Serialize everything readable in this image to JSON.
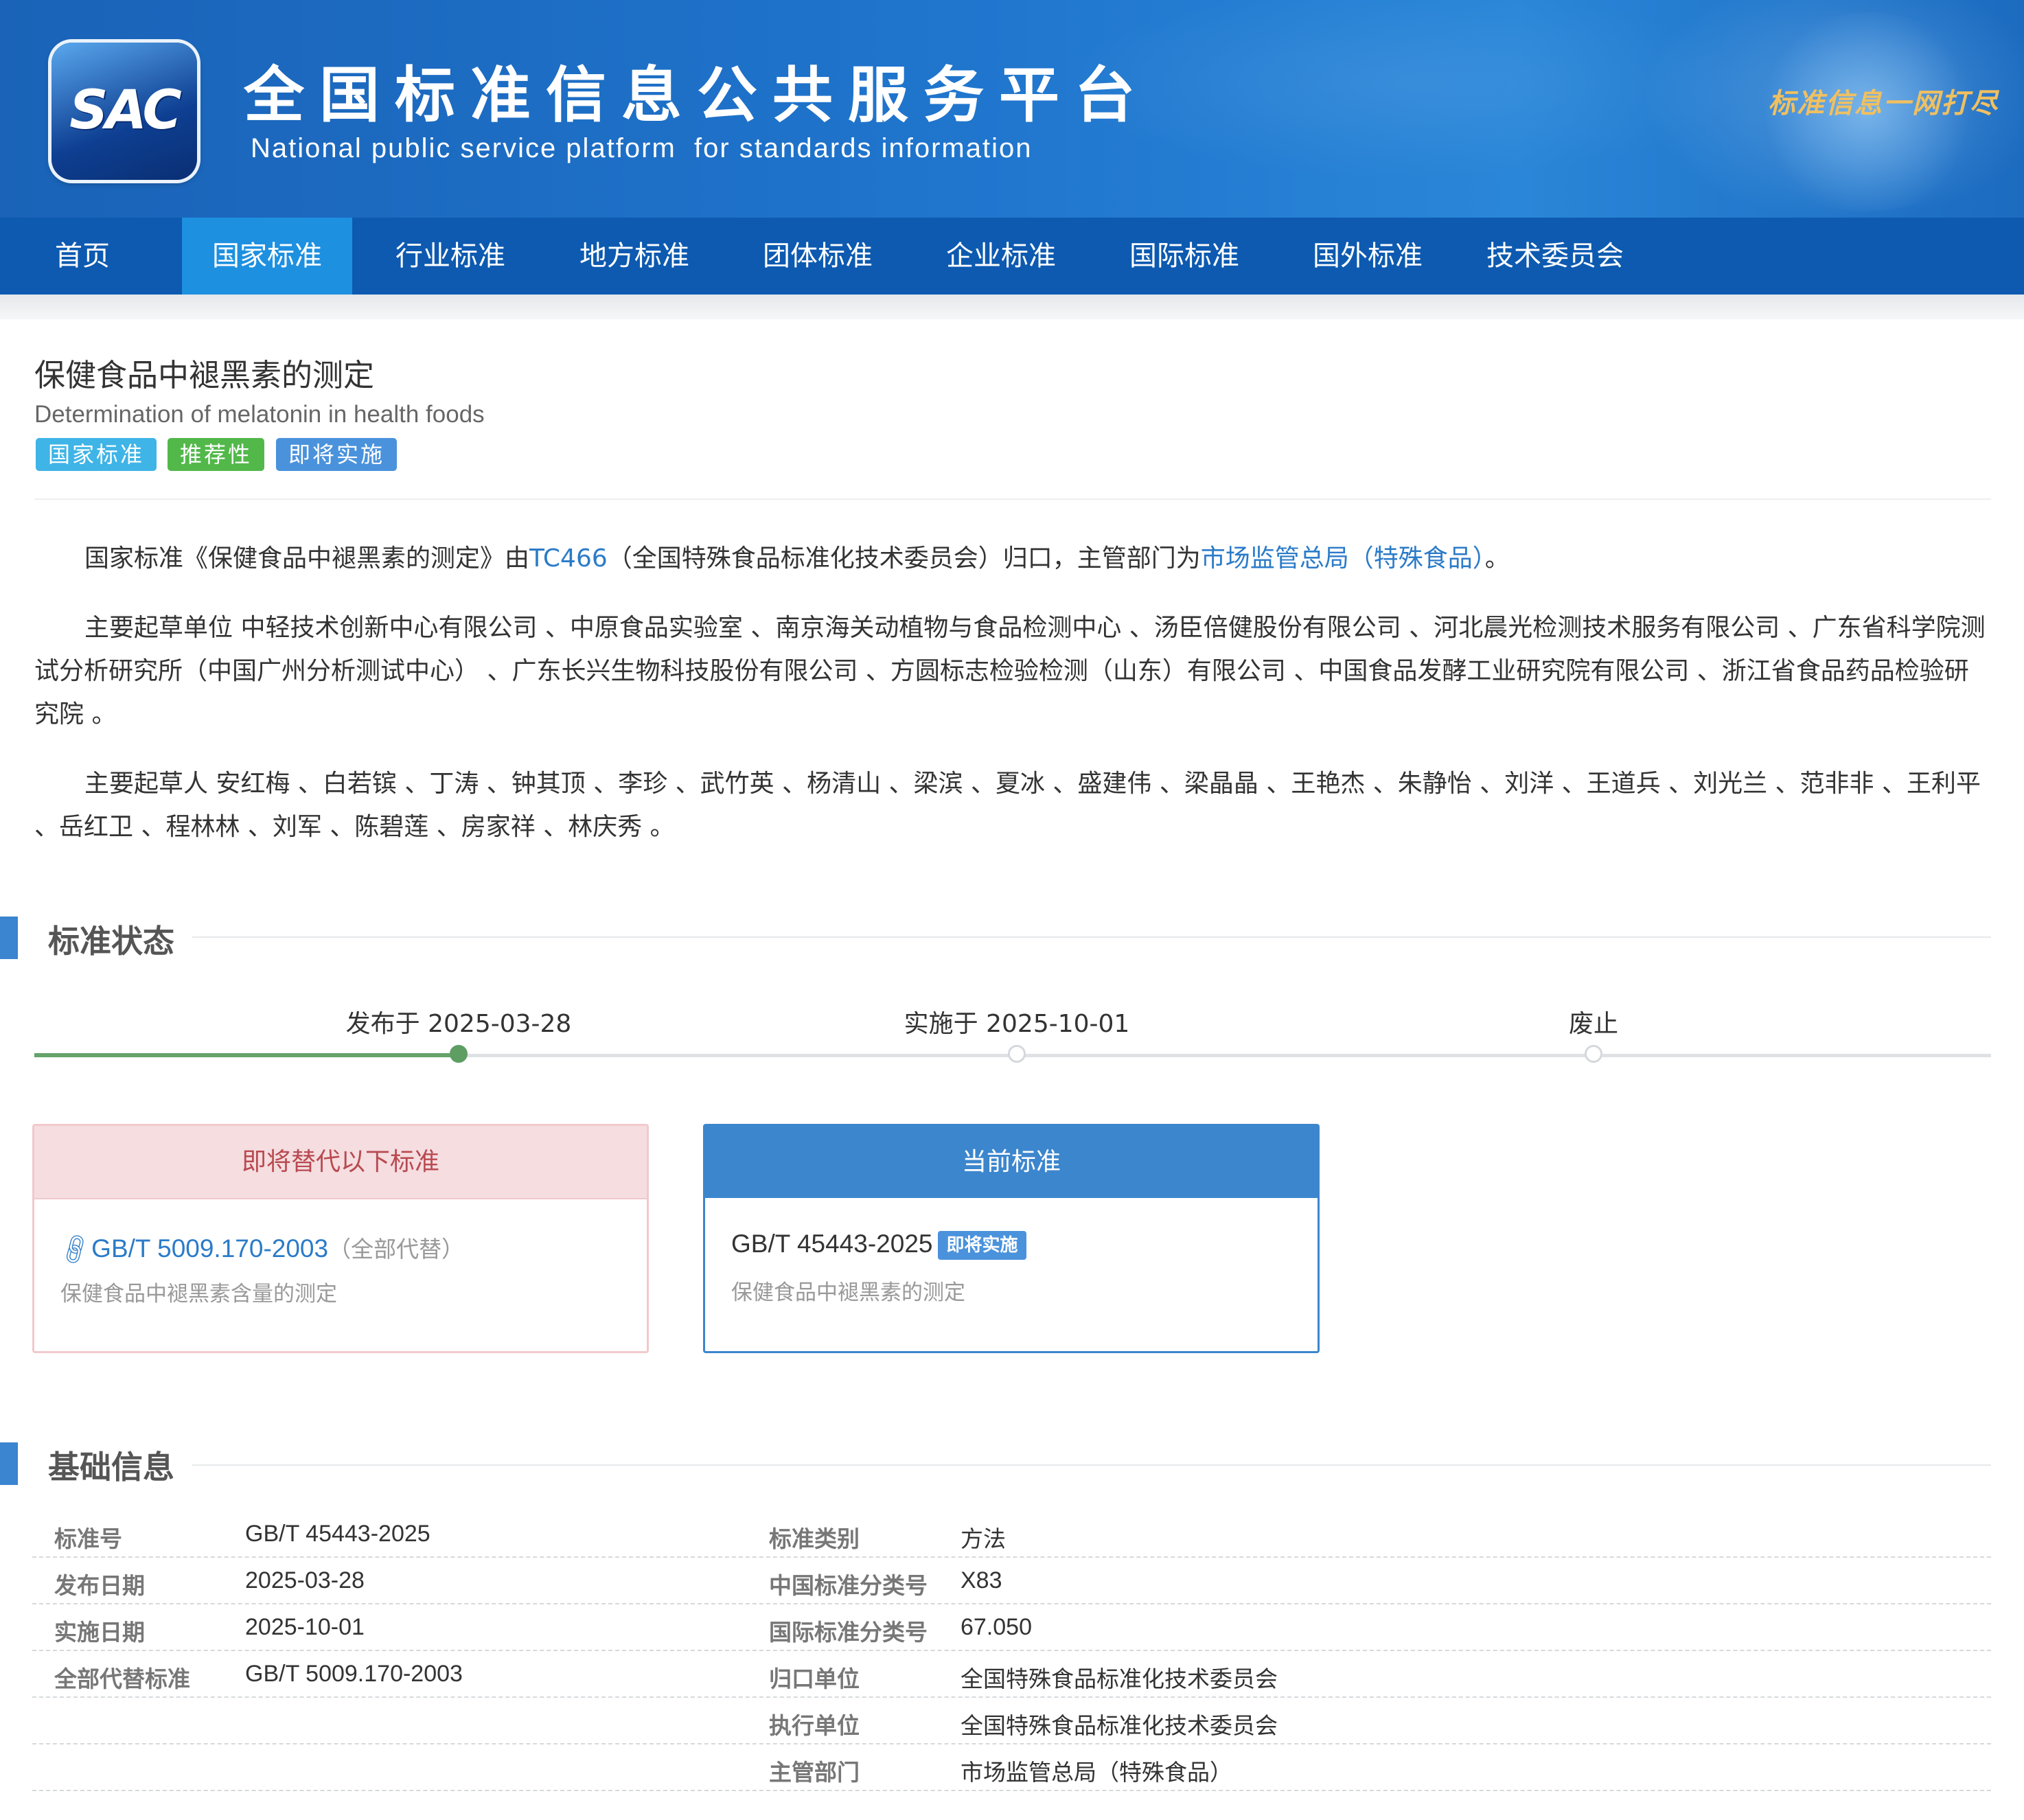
{
  "header": {
    "logo_text": "SAC",
    "title": "全国标准信息公共服务平台",
    "subtitle": "National public service platform  for standards information",
    "slogan": "标准信息一网打尽"
  },
  "nav": {
    "items": [
      "首页",
      "国家标准",
      "行业标准",
      "地方标准",
      "团体标准",
      "企业标准",
      "国际标准",
      "国外标准",
      "技术委员会"
    ],
    "active": "国家标准"
  },
  "standard": {
    "title_cn": "保健食品中褪黑素的测定",
    "title_en": "Determination of melatonin in health foods",
    "tags": [
      {
        "label": "国家标准",
        "color": "#3fb4e6"
      },
      {
        "label": "推荐性",
        "color": "#52b84a"
      },
      {
        "label": "即将实施",
        "color": "#4a92dc"
      }
    ]
  },
  "intro": {
    "p1_a": "国家标准《保健食品中褪黑素的测定》由",
    "p1_tc": "TC466",
    "p1_b": "（全国特殊食品标准化技术委员会）归口，主管部门为",
    "p1_dept": "市场监管总局（特殊食品）",
    "p1_c": "。",
    "p2": "主要起草单位 中轻技术创新中心有限公司 、中原食品实验室 、南京海关动植物与食品检测中心 、汤臣倍健股份有限公司 、河北晨光检测技术服务有限公司 、广东省科学院测试分析研究所（中国广州分析测试中心） 、广东长兴生物科技股份有限公司 、方圆标志检验检测（山东）有限公司 、中国食品发酵工业研究院有限公司 、浙江省食品药品检验研究院 。",
    "p3": "主要起草人 安红梅 、白若镔 、丁涛 、钟其顶 、李珍 、武竹英 、杨清山 、梁滨 、夏冰 、盛建伟 、梁晶晶 、王艳杰 、朱静怡 、刘洋 、王道兵 、刘光兰 、范非非 、王利平 、岳红卫 、程林林 、刘军 、陈碧莲 、房家祥 、林庆秀 。"
  },
  "status_section": {
    "heading": "标准状态",
    "timeline": [
      {
        "label": "发布于 2025-03-28",
        "done": true
      },
      {
        "label": "实施于 2025-10-01",
        "done": false
      },
      {
        "label": "废止",
        "done": false
      }
    ]
  },
  "cards": {
    "replace": {
      "header": "即将替代以下标准",
      "code": "GB/T 5009.170-2003",
      "note": "（全部代替）",
      "name": "保健食品中褪黑素含量的测定"
    },
    "current": {
      "header": "当前标准",
      "code": "GB/T 45443-2025",
      "badge": "即将实施",
      "name": "保健食品中褪黑素的测定"
    }
  },
  "info_section": {
    "heading": "基础信息",
    "rows": [
      {
        "l1": "标准号",
        "v1": "GB/T 45443-2025",
        "l2": "标准类别",
        "v2": "方法",
        "link2": false
      },
      {
        "l1": "发布日期",
        "v1": "2025-03-28",
        "l2": "中国标准分类号",
        "v2": "X83",
        "link2": false
      },
      {
        "l1": "实施日期",
        "v1": "2025-10-01",
        "l2": "国际标准分类号",
        "v2": "67.050",
        "link2": false
      },
      {
        "l1": "全部代替标准",
        "v1": "GB/T 5009.170-2003",
        "l2": "归口单位",
        "v2": "全国特殊食品标准化技术委员会",
        "link2": true
      },
      {
        "l1": "",
        "v1": "",
        "l2": "执行单位",
        "v2": "全国特殊食品标准化技术委员会",
        "link2": true
      },
      {
        "l1": "",
        "v1": "",
        "l2": "主管部门",
        "v2": "市场监管总局（特殊食品）",
        "link2": true
      }
    ]
  }
}
